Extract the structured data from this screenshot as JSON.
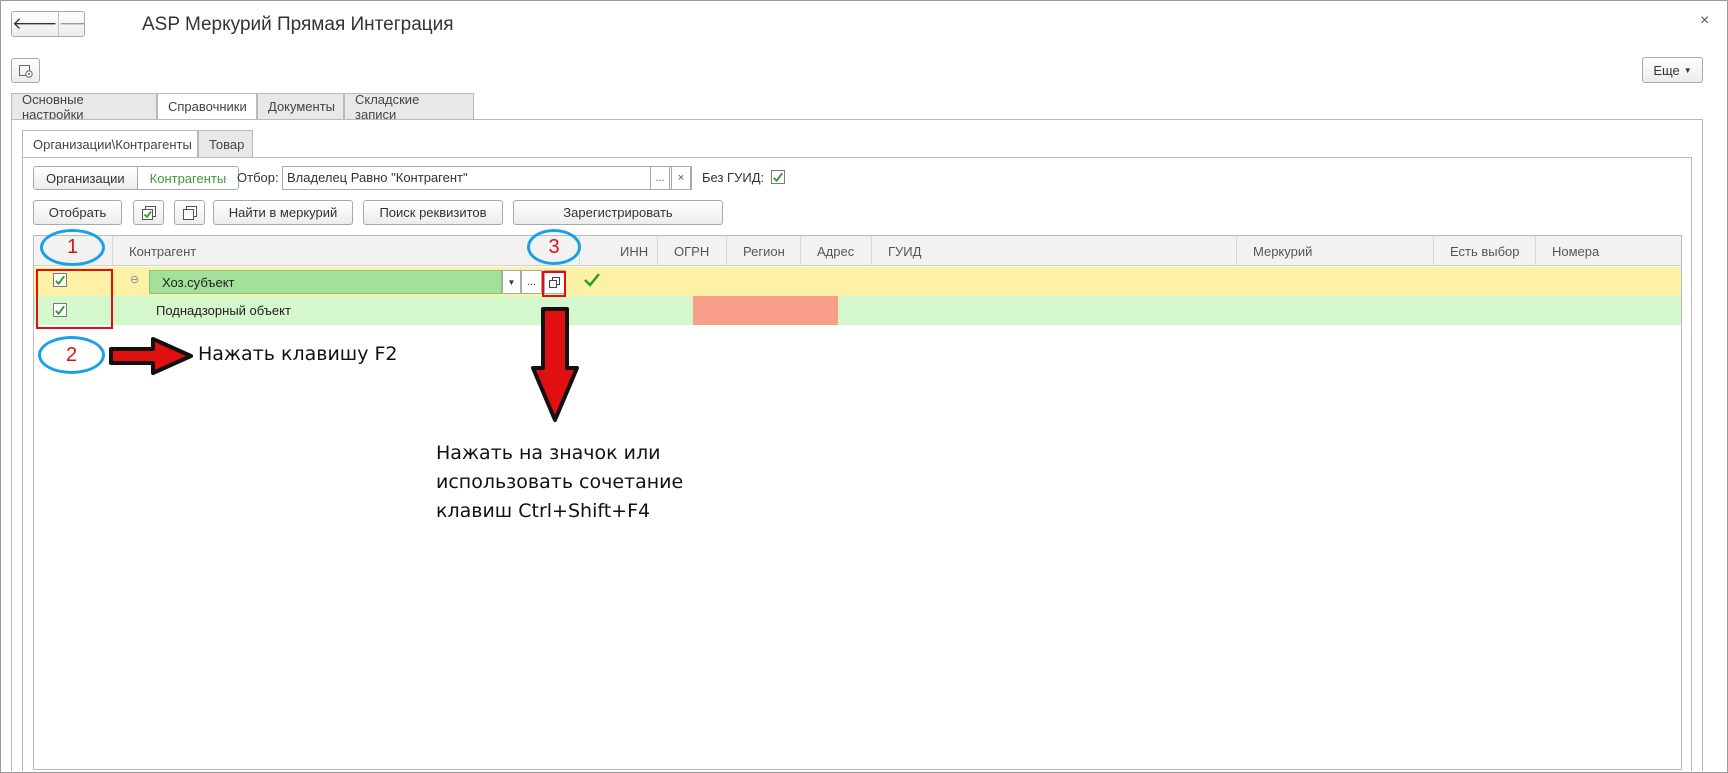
{
  "window": {
    "title": "ASP Меркурий Прямая Интеграция",
    "close": "×"
  },
  "nav": {
    "back": "🡐",
    "forward": "🡒"
  },
  "more_button": "Еще",
  "main_tabs": [
    "Основные настройки",
    "Справочники",
    "Документы",
    "Складские записи"
  ],
  "sub_tabs": [
    "Организации\\Контрагенты",
    "Товар"
  ],
  "toggle": {
    "left": "Организации",
    "right": "Контрагенты"
  },
  "filter": {
    "label": "Отбор:",
    "value": "Владелец Равно \"Контрагент\"",
    "select_btn": "...",
    "clear_btn": "×"
  },
  "no_guid": {
    "label": "Без ГУИД:",
    "checked": true
  },
  "toolbar": {
    "select": "Отобрать",
    "find": "Найти в меркурий",
    "search": "Поиск реквизитов",
    "register": "Зарегистрировать"
  },
  "table": {
    "columns": [
      "Контрагент",
      "ИНН",
      "ОГРН",
      "Регион",
      "Адрес",
      "ГУИД",
      "Меркурий",
      "Есть выбор",
      "Номера"
    ],
    "rows": [
      {
        "checked": true,
        "name": "Хоз.субъект",
        "field_btn": "...",
        "inn_ok": true
      },
      {
        "checked": true,
        "name": "Поднадзорный объект"
      }
    ]
  },
  "annotations": {
    "badge1": "1",
    "badge2": "2",
    "badge3": "3",
    "arrow_text": "Нажать клавишу F2",
    "note": [
      "Нажать на значок или",
      "использовать сочетание",
      "клавиш Ctrl+Shift+F4"
    ]
  },
  "colors": {
    "yellow_row": "#fdf1a6",
    "green_row": "#d5f7cc",
    "red_cell": "#f99f89",
    "accent_green": "#3d9a3d",
    "annotation_red": "#e01010",
    "annotation_blue": "#1aa0e6"
  }
}
